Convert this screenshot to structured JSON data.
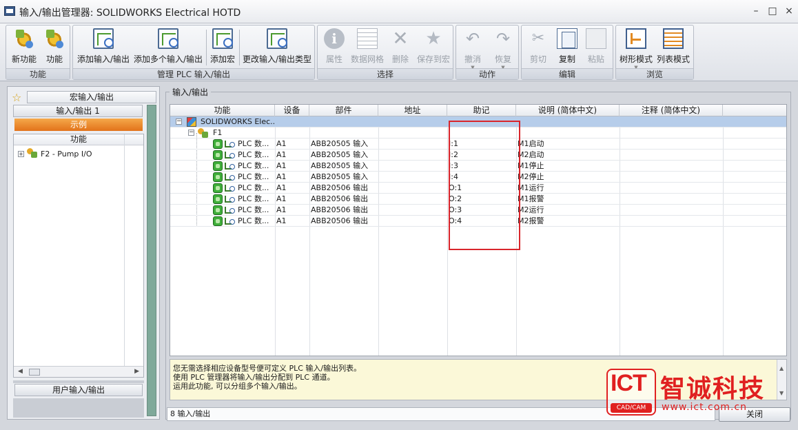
{
  "window": {
    "title": "输入/输出管理器: SOLIDWORKS Electrical HOTD",
    "minimize": "–",
    "restore": "□",
    "close": "×"
  },
  "ribbon": {
    "groups": [
      {
        "label": "功能",
        "buttons": [
          {
            "label": "新功能",
            "icon": "new-function-icon"
          },
          {
            "label": "功能",
            "icon": "function-icon"
          }
        ]
      },
      {
        "label": "管理 PLC 输入/输出",
        "buttons": [
          {
            "label": "添加输入/输出",
            "icon": "add-io-icon"
          },
          {
            "label": "添加多个输入/输出",
            "icon": "add-multiple-io-icon"
          },
          {
            "label": "添加宏",
            "icon": "add-macro-icon"
          },
          {
            "label": "更改输入/输出类型",
            "icon": "change-io-type-icon"
          }
        ]
      },
      {
        "label": "选择",
        "buttons": [
          {
            "label": "属性",
            "icon": "info-icon"
          },
          {
            "label": "数据网格",
            "icon": "grid-icon"
          },
          {
            "label": "删除",
            "icon": "delete-icon"
          },
          {
            "label": "保存到宏",
            "icon": "save-macro-icon"
          }
        ]
      },
      {
        "label": "动作",
        "buttons": [
          {
            "label": "撤消",
            "icon": "undo-icon"
          },
          {
            "label": "恢复",
            "icon": "redo-icon"
          }
        ]
      },
      {
        "label": "编辑",
        "buttons": [
          {
            "label": "剪切",
            "icon": "cut-icon"
          },
          {
            "label": "复制",
            "icon": "copy-icon"
          },
          {
            "label": "粘贴",
            "icon": "paste-icon"
          }
        ]
      },
      {
        "label": "浏览",
        "buttons": [
          {
            "label": "树形模式",
            "icon": "tree-mode-icon"
          },
          {
            "label": "列表模式",
            "icon": "list-mode-icon"
          }
        ]
      }
    ]
  },
  "left": {
    "macro_tab": "宏输入/输出",
    "io_tab": "输入/输出 1",
    "example": "示例",
    "column": "功能",
    "tree_item": "F2 - Pump I/O",
    "user_io_tab": "用户输入/输出"
  },
  "right": {
    "panel_title": "输入/输出",
    "columns": [
      "功能",
      "设备",
      "部件",
      "地址",
      "助记",
      "说明 (简体中文)",
      "注释 (简体中文)"
    ],
    "root": "SOLIDWORKS Elec...",
    "f1": "F1",
    "rows": [
      {
        "func": "PLC 数...",
        "device": "A1",
        "part": "ABB20505 输入",
        "addr": "",
        "mnemonic": "I:1",
        "desc": "M1启动",
        "note": ""
      },
      {
        "func": "PLC 数...",
        "device": "A1",
        "part": "ABB20505 输入",
        "addr": "",
        "mnemonic": "I:2",
        "desc": "M2启动",
        "note": ""
      },
      {
        "func": "PLC 数...",
        "device": "A1",
        "part": "ABB20505 输入",
        "addr": "",
        "mnemonic": "I:3",
        "desc": "M1停止",
        "note": ""
      },
      {
        "func": "PLC 数...",
        "device": "A1",
        "part": "ABB20505 输入",
        "addr": "",
        "mnemonic": "I:4",
        "desc": "M2停止",
        "note": ""
      },
      {
        "func": "PLC 数...",
        "device": "A1",
        "part": "ABB20506 输出",
        "addr": "",
        "mnemonic": "O:1",
        "desc": "M1运行",
        "note": ""
      },
      {
        "func": "PLC 数...",
        "device": "A1",
        "part": "ABB20506 输出",
        "addr": "",
        "mnemonic": "O:2",
        "desc": "M1报警",
        "note": ""
      },
      {
        "func": "PLC 数...",
        "device": "A1",
        "part": "ABB20506 输出",
        "addr": "",
        "mnemonic": "O:3",
        "desc": "M2运行",
        "note": ""
      },
      {
        "func": "PLC 数...",
        "device": "A1",
        "part": "ABB20506 输出",
        "addr": "",
        "mnemonic": "O:4",
        "desc": "M2报警",
        "note": ""
      }
    ],
    "info_lines": [
      "您无需选择相应设备型号便可定义 PLC 输入/输出列表。",
      "使用 PLC 管理器将输入/输出分配到 PLC 通道。",
      "运用此功能, 可以分组多个输入/输出。"
    ],
    "status": "8 输入/输出",
    "close_button": "关闭"
  },
  "watermark": {
    "logo": "ICT",
    "tag": "CAD/CAM",
    "name": "智诚科技",
    "url": "www.ict.com.cn"
  },
  "colors": {
    "accent_orange": "#e3731a",
    "selection": "#b6cdea",
    "highlight_red": "#d9252b",
    "info_bg": "#fbf8d8"
  }
}
